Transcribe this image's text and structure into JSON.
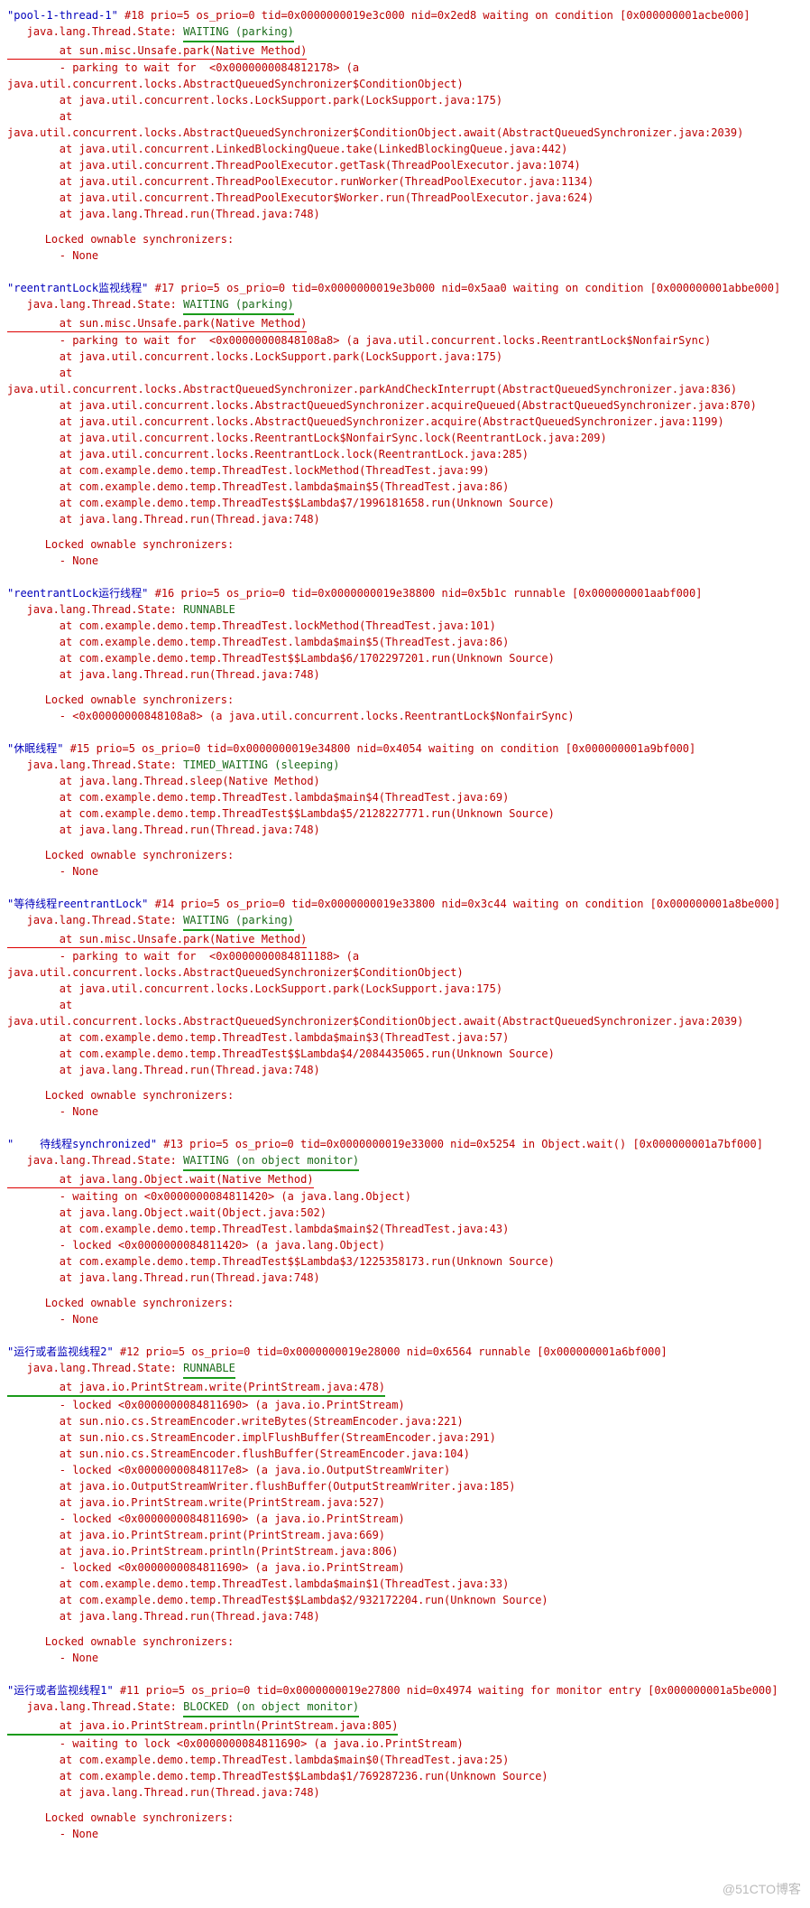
{
  "watermark": "@51CTO博客",
  "threads": [
    {
      "header_name": "\"pool-1-thread-1\"",
      "header_rest": " #18 prio=5 os_prio=0 tid=0x0000000019e3c000 nid=0x2ed8 waiting on condition [0x000000001acbe000]",
      "state_label": "   java.lang.Thread.State: ",
      "state_text": "WAITING (parking)",
      "state_ul": "green",
      "first_trace": "        at sun.misc.Unsafe.park(Native Method)",
      "first_ul": "red",
      "traces": [
        "        - parking to wait for  <0x0000000084812178> (a java.util.concurrent.locks.AbstractQueuedSynchronizer$ConditionObject)",
        "        at java.util.concurrent.locks.LockSupport.park(LockSupport.java:175)",
        "        at java.util.concurrent.locks.AbstractQueuedSynchronizer$ConditionObject.await(AbstractQueuedSynchronizer.java:2039)",
        "        at java.util.concurrent.LinkedBlockingQueue.take(LinkedBlockingQueue.java:442)",
        "        at java.util.concurrent.ThreadPoolExecutor.getTask(ThreadPoolExecutor.java:1074)",
        "        at java.util.concurrent.ThreadPoolExecutor.runWorker(ThreadPoolExecutor.java:1134)",
        "        at java.util.concurrent.ThreadPoolExecutor$Worker.run(ThreadPoolExecutor.java:624)",
        "        at java.lang.Thread.run(Thread.java:748)"
      ],
      "sync_header": "   Locked ownable synchronizers:",
      "sync_items": [
        "        - None"
      ]
    },
    {
      "header_name": "\"reentrantLock监视线程\"",
      "header_rest": " #17 prio=5 os_prio=0 tid=0x0000000019e3b000 nid=0x5aa0 waiting on condition [0x000000001abbe000]",
      "state_label": "   java.lang.Thread.State: ",
      "state_text": "WAITING (parking)",
      "state_ul": "green",
      "first_trace": "        at sun.misc.Unsafe.park(Native Method)",
      "first_ul": "red",
      "traces": [
        "        - parking to wait for  <0x00000000848108a8> (a java.util.concurrent.locks.ReentrantLock$NonfairSync)",
        "        at java.util.concurrent.locks.LockSupport.park(LockSupport.java:175)",
        "        at java.util.concurrent.locks.AbstractQueuedSynchronizer.parkAndCheckInterrupt(AbstractQueuedSynchronizer.java:836)",
        "        at java.util.concurrent.locks.AbstractQueuedSynchronizer.acquireQueued(AbstractQueuedSynchronizer.java:870)",
        "        at java.util.concurrent.locks.AbstractQueuedSynchronizer.acquire(AbstractQueuedSynchronizer.java:1199)",
        "        at java.util.concurrent.locks.ReentrantLock$NonfairSync.lock(ReentrantLock.java:209)",
        "        at java.util.concurrent.locks.ReentrantLock.lock(ReentrantLock.java:285)",
        "        at com.example.demo.temp.ThreadTest.lockMethod(ThreadTest.java:99)",
        "        at com.example.demo.temp.ThreadTest.lambda$main$5(ThreadTest.java:86)",
        "        at com.example.demo.temp.ThreadTest$$Lambda$7/1996181658.run(Unknown Source)",
        "        at java.lang.Thread.run(Thread.java:748)"
      ],
      "sync_header": "   Locked ownable synchronizers:",
      "sync_items": [
        "        - None"
      ]
    },
    {
      "header_name": "\"reentrantLock运行线程\"",
      "header_rest": " #16 prio=5 os_prio=0 tid=0x0000000019e38800 nid=0x5b1c runnable [0x000000001aabf000]",
      "state_label": "   java.lang.Thread.State: ",
      "state_text": "RUNNABLE",
      "state_ul": "none",
      "first_trace": "        at com.example.demo.temp.ThreadTest.lockMethod(ThreadTest.java:101)",
      "first_ul": "none",
      "traces": [
        "        at com.example.demo.temp.ThreadTest.lambda$main$5(ThreadTest.java:86)",
        "        at com.example.demo.temp.ThreadTest$$Lambda$6/1702297201.run(Unknown Source)",
        "        at java.lang.Thread.run(Thread.java:748)"
      ],
      "sync_header": "   Locked ownable synchronizers:",
      "sync_items": [
        "        - <0x00000000848108a8> (a java.util.concurrent.locks.ReentrantLock$NonfairSync)"
      ]
    },
    {
      "header_name": "\"休眠线程\"",
      "header_rest": " #15 prio=5 os_prio=0 tid=0x0000000019e34800 nid=0x4054 waiting on condition [0x000000001a9bf000]",
      "state_label": "   java.lang.Thread.State: ",
      "state_text": "TIMED_WAITING (sleeping)",
      "state_ul": "none",
      "first_trace": "        at java.lang.Thread.sleep(Native Method)",
      "first_ul": "none",
      "traces": [
        "        at com.example.demo.temp.ThreadTest.lambda$main$4(ThreadTest.java:69)",
        "        at com.example.demo.temp.ThreadTest$$Lambda$5/2128227771.run(Unknown Source)",
        "        at java.lang.Thread.run(Thread.java:748)"
      ],
      "sync_header": "   Locked ownable synchronizers:",
      "sync_items": [
        "        - None"
      ]
    },
    {
      "header_name": "\"等待线程reentrantLock\"",
      "header_rest": " #14 prio=5 os_prio=0 tid=0x0000000019e33800 nid=0x3c44 waiting on condition [0x000000001a8be000]",
      "state_label": "   java.lang.Thread.State: ",
      "state_text": "WAITING (parking)",
      "state_ul": "green",
      "first_trace": "        at sun.misc.Unsafe.park(Native Method)",
      "first_ul": "red",
      "traces": [
        "        - parking to wait for  <0x0000000084811188> (a java.util.concurrent.locks.AbstractQueuedSynchronizer$ConditionObject)",
        "        at java.util.concurrent.locks.LockSupport.park(LockSupport.java:175)",
        "        at java.util.concurrent.locks.AbstractQueuedSynchronizer$ConditionObject.await(AbstractQueuedSynchronizer.java:2039)",
        "        at com.example.demo.temp.ThreadTest.lambda$main$3(ThreadTest.java:57)",
        "        at com.example.demo.temp.ThreadTest$$Lambda$4/2084435065.run(Unknown Source)",
        "        at java.lang.Thread.run(Thread.java:748)"
      ],
      "sync_header": "   Locked ownable synchronizers:",
      "sync_items": [
        "        - None"
      ]
    },
    {
      "header_name": "\"    待线程synchronized\"",
      "header_rest": " #13 prio=5 os_prio=0 tid=0x0000000019e33000 nid=0x5254 in Object.wait() [0x000000001a7bf000]",
      "state_label": "   java.lang.Thread.State: ",
      "state_text": "WAITING (on object monitor)",
      "state_ul": "green",
      "first_trace": "        at java.lang.Object.wait(Native Method)",
      "first_ul": "red",
      "traces": [
        "        - waiting on <0x0000000084811420> (a java.lang.Object)",
        "        at java.lang.Object.wait(Object.java:502)",
        "        at com.example.demo.temp.ThreadTest.lambda$main$2(ThreadTest.java:43)",
        "        - locked <0x0000000084811420> (a java.lang.Object)",
        "        at com.example.demo.temp.ThreadTest$$Lambda$3/1225358173.run(Unknown Source)",
        "        at java.lang.Thread.run(Thread.java:748)"
      ],
      "sync_header": "   Locked ownable synchronizers:",
      "sync_items": [
        "        - None"
      ]
    },
    {
      "header_name": "\"运行或者监视线程2\"",
      "header_rest": " #12 prio=5 os_prio=0 tid=0x0000000019e28000 nid=0x6564 runnable [0x000000001a6bf000]",
      "state_label": "   java.lang.Thread.State: ",
      "state_text": "RUNNABLE",
      "state_ul": "green",
      "first_trace": "        at java.io.PrintStream.write(PrintStream.java:478)",
      "first_ul": "green",
      "traces": [
        "        - locked <0x0000000084811690> (a java.io.PrintStream)",
        "        at sun.nio.cs.StreamEncoder.writeBytes(StreamEncoder.java:221)",
        "        at sun.nio.cs.StreamEncoder.implFlushBuffer(StreamEncoder.java:291)",
        "        at sun.nio.cs.StreamEncoder.flushBuffer(StreamEncoder.java:104)",
        "        - locked <0x00000000848117e8> (a java.io.OutputStreamWriter)",
        "        at java.io.OutputStreamWriter.flushBuffer(OutputStreamWriter.java:185)",
        "        at java.io.PrintStream.write(PrintStream.java:527)",
        "        - locked <0x0000000084811690> (a java.io.PrintStream)",
        "        at java.io.PrintStream.print(PrintStream.java:669)",
        "        at java.io.PrintStream.println(PrintStream.java:806)",
        "        - locked <0x0000000084811690> (a java.io.PrintStream)",
        "        at com.example.demo.temp.ThreadTest.lambda$main$1(ThreadTest.java:33)",
        "        at com.example.demo.temp.ThreadTest$$Lambda$2/932172204.run(Unknown Source)",
        "        at java.lang.Thread.run(Thread.java:748)"
      ],
      "sync_header": "   Locked ownable synchronizers:",
      "sync_items": [
        "        - None"
      ]
    },
    {
      "header_name": "\"运行或者监视线程1\"",
      "header_rest": " #11 prio=5 os_prio=0 tid=0x0000000019e27800 nid=0x4974 waiting for monitor entry [0x000000001a5be000]",
      "state_label": "   java.lang.Thread.State: ",
      "state_text": "BLOCKED (on object monitor)",
      "state_ul": "green",
      "first_trace": "        at java.io.PrintStream.println(PrintStream.java:805)",
      "first_ul": "green",
      "traces": [
        "        - waiting to lock <0x0000000084811690> (a java.io.PrintStream)",
        "        at com.example.demo.temp.ThreadTest.lambda$main$0(ThreadTest.java:25)",
        "        at com.example.demo.temp.ThreadTest$$Lambda$1/769287236.run(Unknown Source)",
        "        at java.lang.Thread.run(Thread.java:748)"
      ],
      "sync_header": "   Locked ownable synchronizers:",
      "sync_items": [
        "        - None"
      ]
    }
  ]
}
